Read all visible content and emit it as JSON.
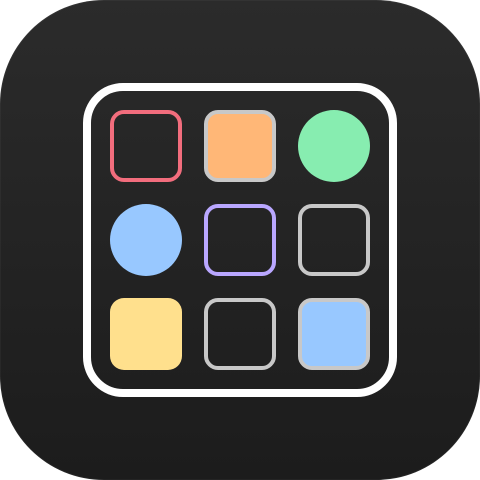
{
  "app": {
    "icon_name": "grid-tiles-app-icon",
    "background_color": "#222222",
    "board_border_color": "#ffffff"
  },
  "tiles": [
    {
      "row": 1,
      "col": 1,
      "shape": "square",
      "style": "outline",
      "color": "#f26d7d"
    },
    {
      "row": 1,
      "col": 2,
      "shape": "square",
      "style": "filled-outlined",
      "color": "#ffb777",
      "outline_color": "#c8c8c8"
    },
    {
      "row": 1,
      "col": 3,
      "shape": "circle",
      "style": "filled",
      "color": "#87edb0"
    },
    {
      "row": 2,
      "col": 1,
      "shape": "circle",
      "style": "filled",
      "color": "#98c8ff"
    },
    {
      "row": 2,
      "col": 2,
      "shape": "square",
      "style": "outline",
      "color": "#b9a7ff"
    },
    {
      "row": 2,
      "col": 3,
      "shape": "square",
      "style": "outline",
      "color": "#c8c8c8"
    },
    {
      "row": 3,
      "col": 1,
      "shape": "square",
      "style": "filled",
      "color": "#ffe08d"
    },
    {
      "row": 3,
      "col": 2,
      "shape": "square",
      "style": "outline",
      "color": "#c8c8c8"
    },
    {
      "row": 3,
      "col": 3,
      "shape": "square",
      "style": "filled-outlined",
      "color": "#98c8ff",
      "outline_color": "#c8c8c8"
    }
  ]
}
